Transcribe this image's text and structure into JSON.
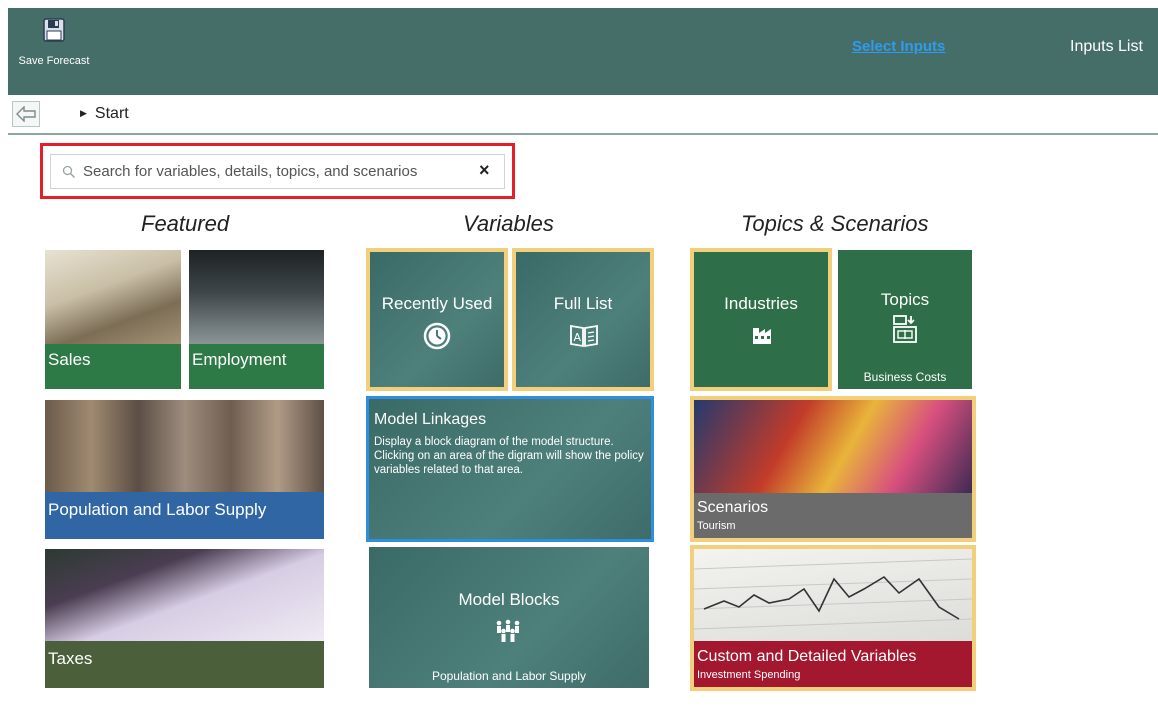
{
  "ribbon": {
    "save_label": "Save Forecast",
    "select_inputs": "Select Inputs",
    "inputs_list": "Inputs List"
  },
  "breadcrumb": {
    "item": "Start"
  },
  "search": {
    "placeholder": "Search for variables, details, topics, and scenarios",
    "clear": "×"
  },
  "columns": {
    "featured": "Featured",
    "variables": "Variables",
    "topics": "Topics & Scenarios"
  },
  "featured": {
    "sales": "Sales",
    "employment": "Employment",
    "population": "Population and Labor Supply",
    "taxes": "Taxes"
  },
  "variables": {
    "recently_used": "Recently Used",
    "full_list": "Full List",
    "model_linkages_title": "Model Linkages",
    "model_linkages_desc": "Display a block diagram of the model structure.  Clicking on an area of the digram will show the policy variables related to that area.",
    "model_blocks_title": "Model Blocks",
    "model_blocks_sub": "Population and Labor Supply"
  },
  "topics": {
    "industries": "Industries",
    "topics_title": "Topics",
    "topics_sub": "Business Costs",
    "scenarios_title": "Scenarios",
    "scenarios_sub": "Tourism",
    "custom_title": "Custom and Detailed Variables",
    "custom_sub": "Investment Spending"
  },
  "colors": {
    "ribbon": "#466e69",
    "select_inputs_link": "#2e9bf0",
    "search_highlight": "#e2202a",
    "tile_gold_border": "#f2cf7a",
    "selected_border": "#2e8ee0",
    "green_bar": "#2e7a46",
    "blue_bar": "#2f66a3",
    "olive_bar": "#4a5f3a",
    "gray_bar": "#6b6b6b",
    "crimson_bar": "#a3172f"
  }
}
